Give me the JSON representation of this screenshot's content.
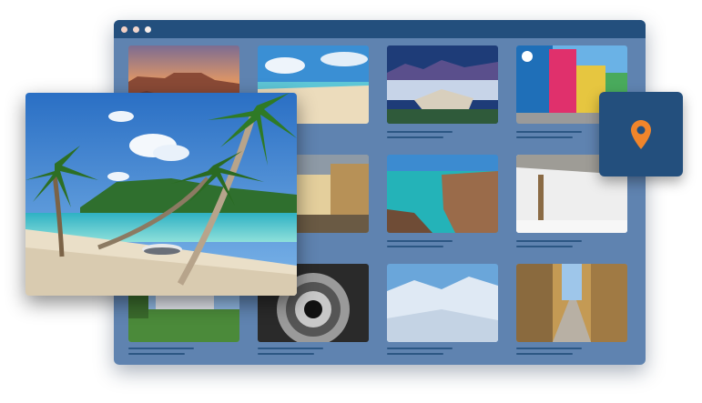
{
  "window": {
    "controls": [
      "close",
      "minimize",
      "maximize"
    ]
  },
  "gallery": {
    "tiles": [
      {
        "name": "desert-mesa-sunset"
      },
      {
        "name": "sandy-beach-blue-sky"
      },
      {
        "name": "misty-mountain-lodge"
      },
      {
        "name": "colorful-street-houses"
      },
      {
        "name": "tropical-beach-palm-trees",
        "featured": true
      },
      {
        "name": "modern-building-atrium"
      },
      {
        "name": "turquoise-rocky-coast"
      },
      {
        "name": "white-gallery-room"
      },
      {
        "name": "castle-garden"
      },
      {
        "name": "spiral-staircase"
      },
      {
        "name": "snowy-mountain-slopes"
      },
      {
        "name": "old-town-alley"
      }
    ]
  },
  "location_button": {
    "icon": "map-pin-icon"
  },
  "colors": {
    "window_bg": "#5f83b0",
    "titlebar": "#234f7d",
    "accent_pin": "#f0852b"
  }
}
